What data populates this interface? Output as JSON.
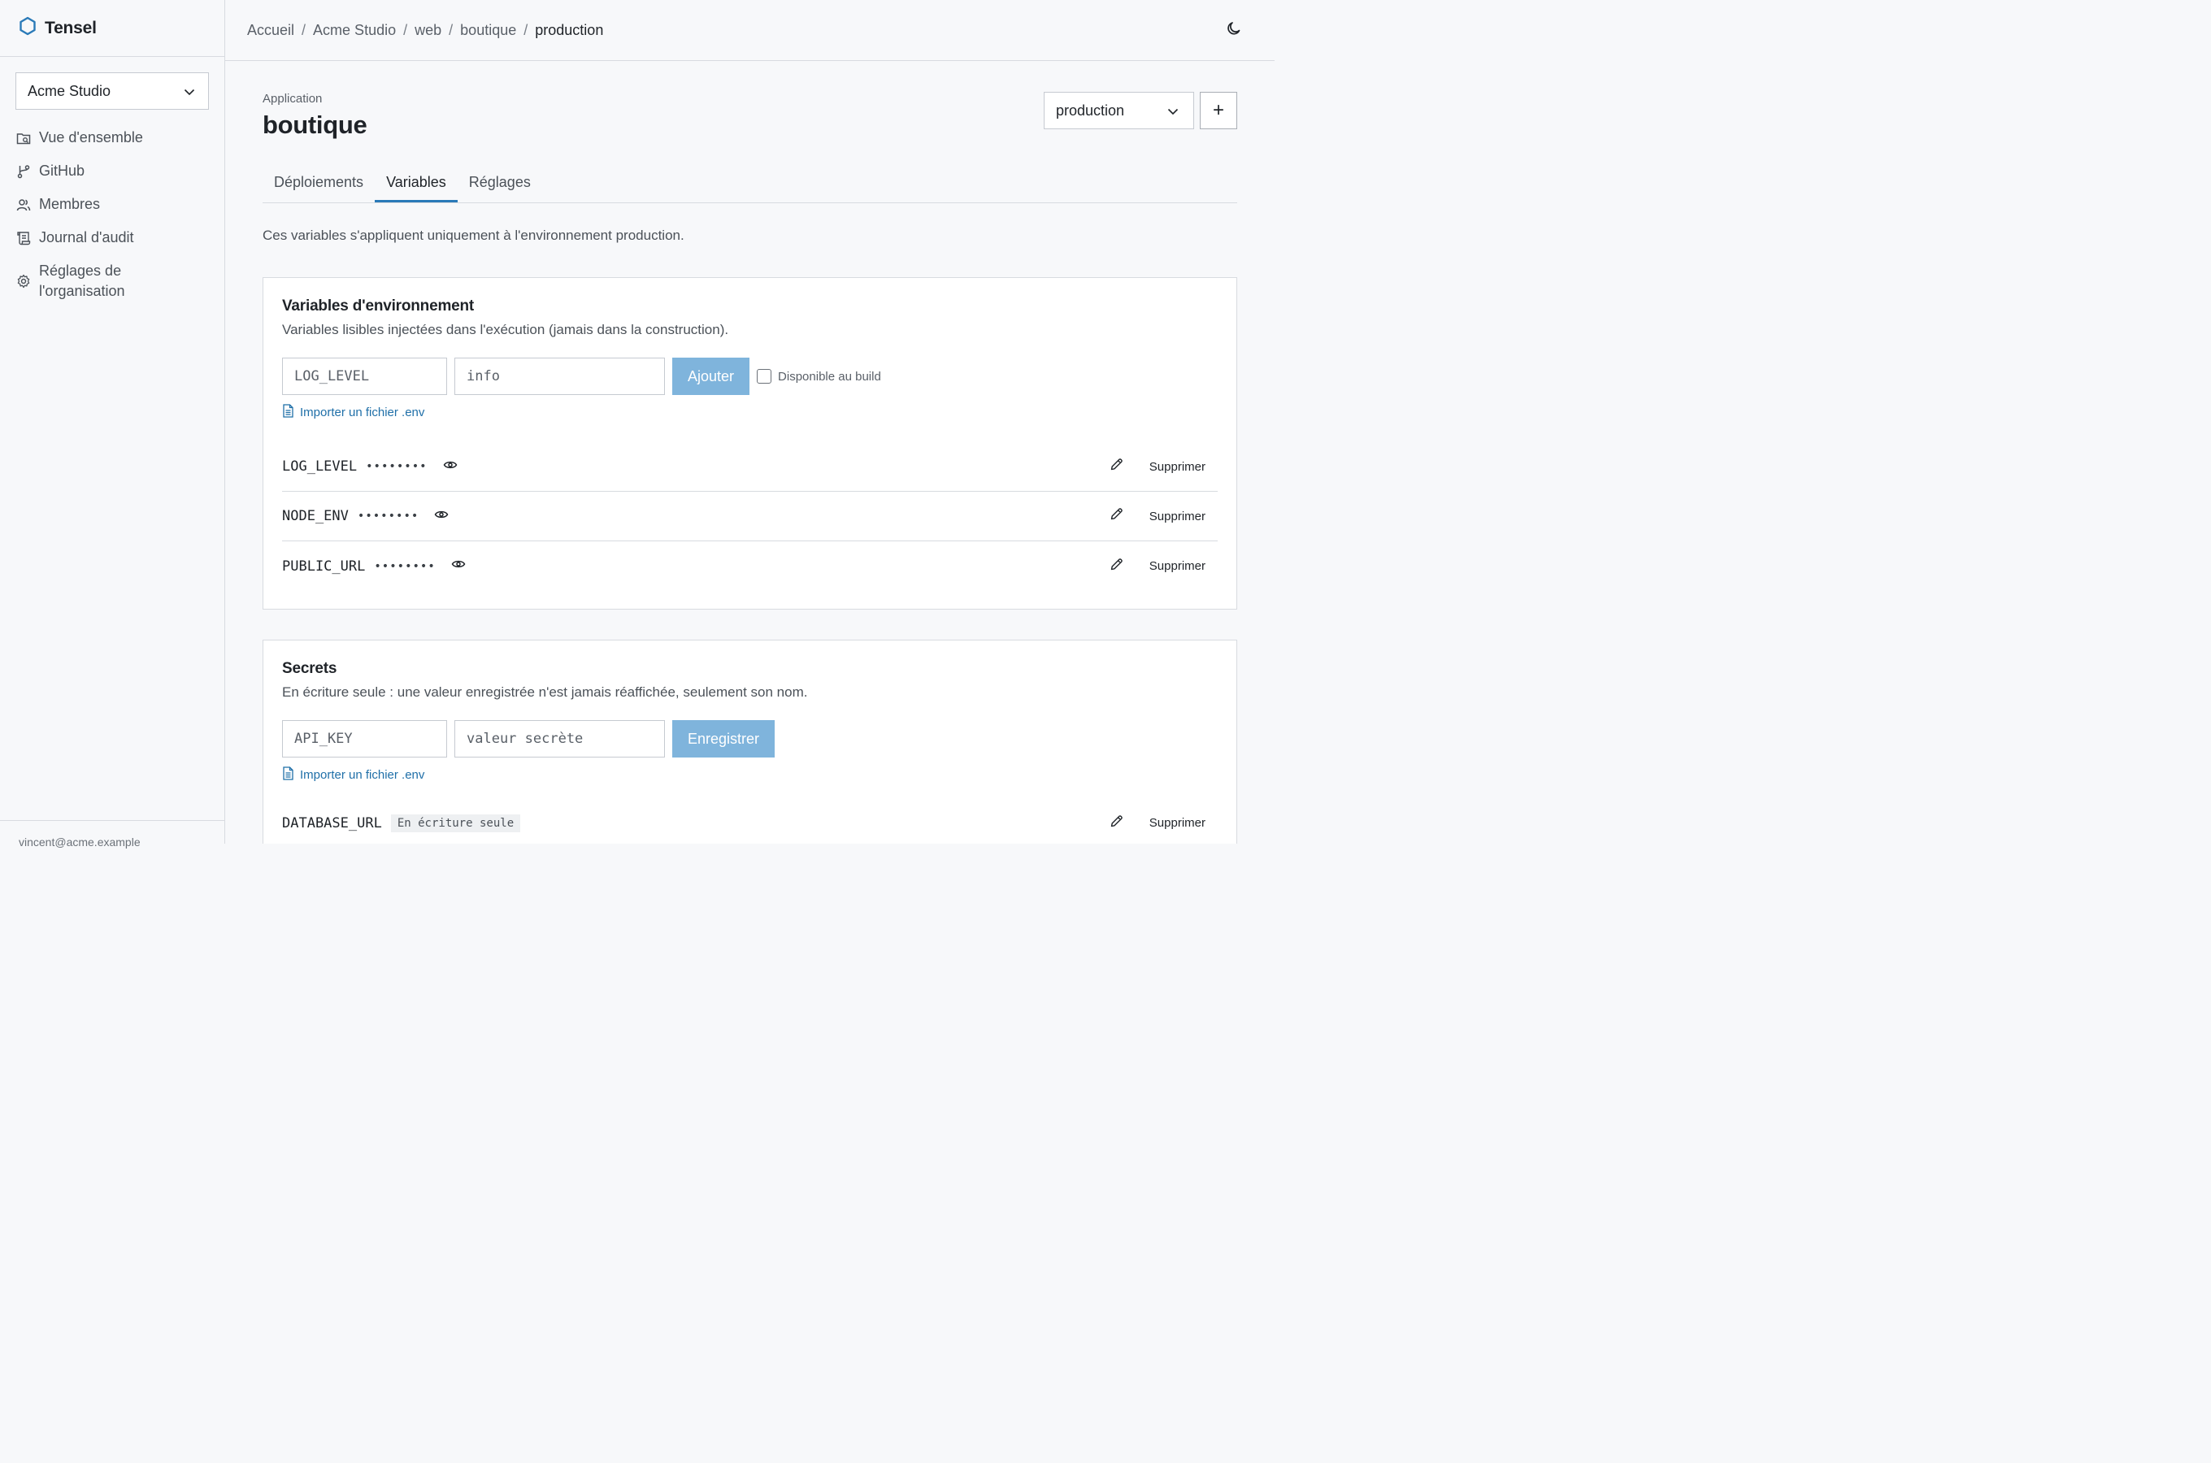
{
  "brand": {
    "name": "Tensel"
  },
  "sidebar": {
    "org": "Acme Studio",
    "items": [
      {
        "label": "Vue d'ensemble",
        "icon": "overview-icon"
      },
      {
        "label": "GitHub",
        "icon": "git-branch-icon"
      },
      {
        "label": "Membres",
        "icon": "users-icon"
      },
      {
        "label": "Journal d'audit",
        "icon": "scroll-icon"
      },
      {
        "label_line1": "Réglages de",
        "label_line2": "l'organisation",
        "icon": "gear-icon"
      }
    ],
    "footer": "vincent@acme.example"
  },
  "breadcrumb": [
    "Accueil",
    "Acme Studio",
    "web",
    "boutique",
    "production"
  ],
  "header": {
    "label": "Application",
    "title": "boutique",
    "env_selected": "production",
    "add_label": "+"
  },
  "tabs": [
    "Déploiements",
    "Variables",
    "Réglages"
  ],
  "note": "Ces variables s'appliquent uniquement à l'environnement production.",
  "env_card": {
    "title": "Variables d'environnement",
    "desc": "Variables lisibles injectées dans l'exécution (jamais dans la construction).",
    "key_placeholder": "LOG_LEVEL",
    "value_placeholder": "info",
    "add_label": "Ajouter",
    "build_label": "Disponible au build",
    "import_label": "Importer un fichier .env",
    "rows": [
      {
        "name": "LOG_LEVEL",
        "mask": "••••••••",
        "delete": "Supprimer"
      },
      {
        "name": "NODE_ENV",
        "mask": "••••••••",
        "delete": "Supprimer"
      },
      {
        "name": "PUBLIC_URL",
        "mask": "••••••••",
        "delete": "Supprimer"
      }
    ]
  },
  "secret_card": {
    "title": "Secrets",
    "desc": "En écriture seule : une valeur enregistrée n'est jamais réaffichée, seulement son nom.",
    "key_placeholder": "API_KEY",
    "value_placeholder": "valeur secrète",
    "save_label": "Enregistrer",
    "import_label": "Importer un fichier .env",
    "rows": [
      {
        "name": "DATABASE_URL",
        "badge": "En écriture seule",
        "delete": "Supprimer"
      }
    ]
  },
  "colors": {
    "accent": "#2a7ab8",
    "button": "#7fb4dc",
    "link": "#1f6fa8"
  }
}
